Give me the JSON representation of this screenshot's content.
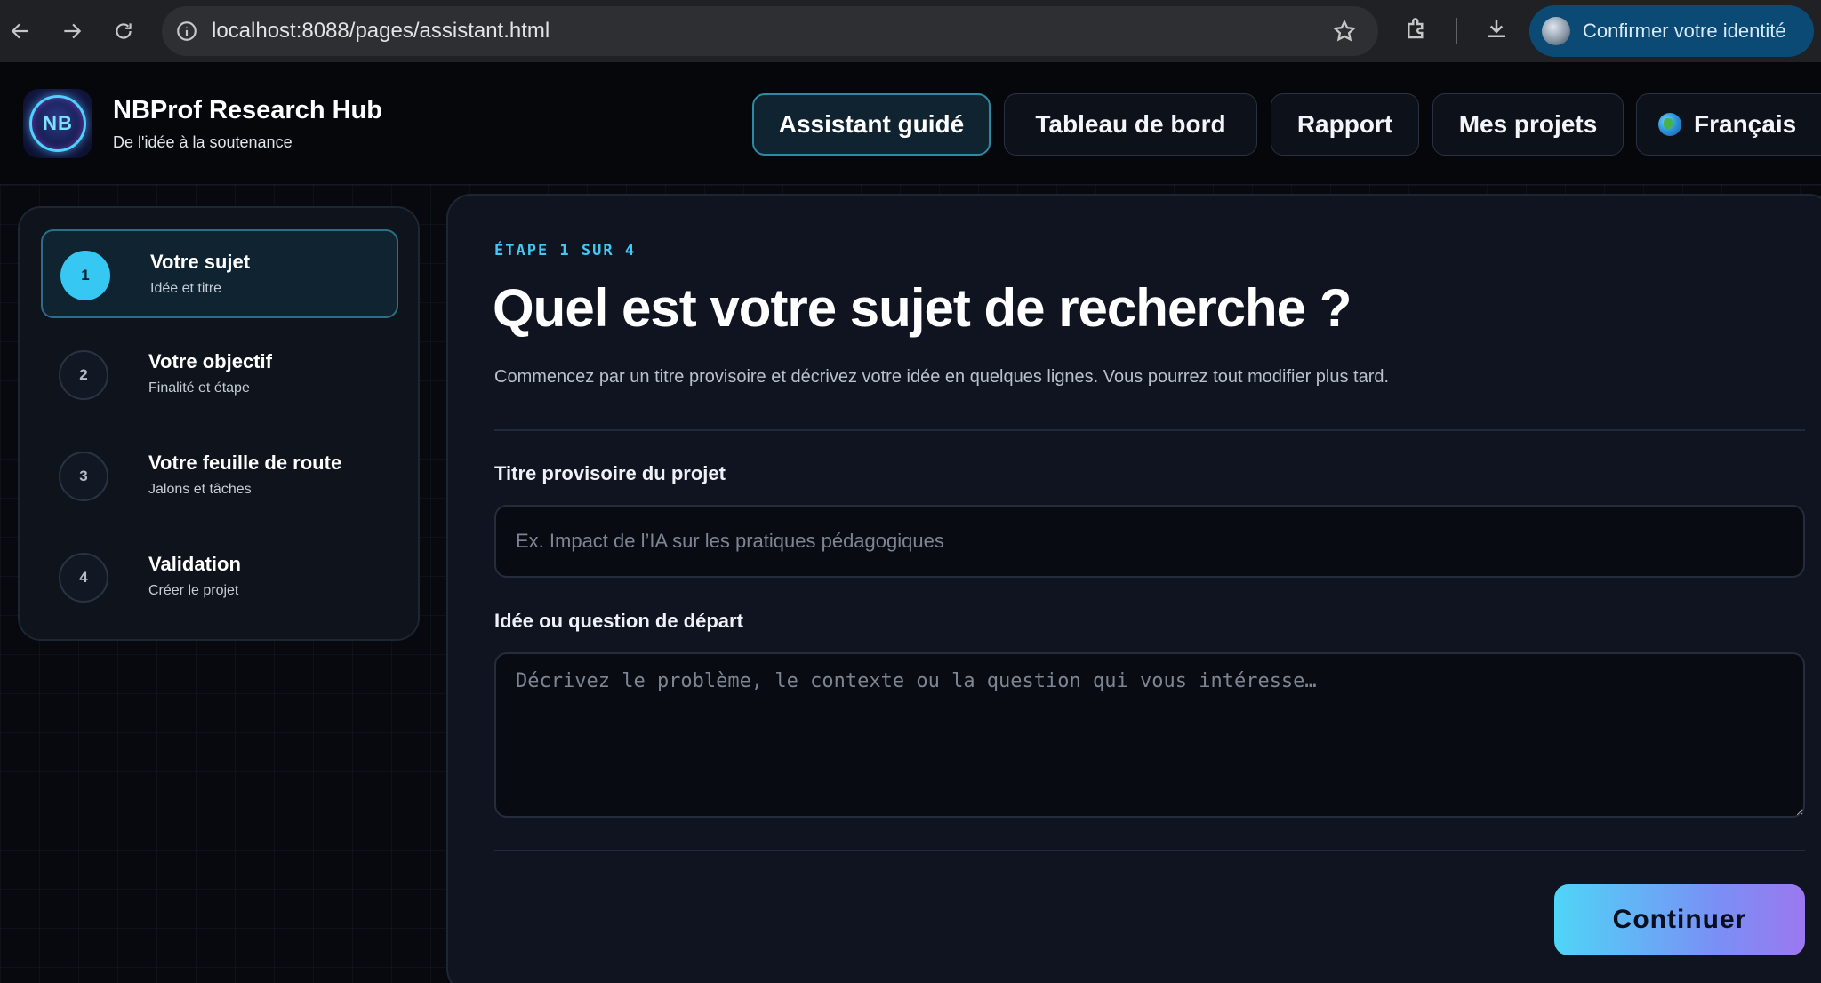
{
  "browser": {
    "url": "localhost:8088/pages/assistant.html",
    "profile_label": "Confirmer votre identité",
    "icons": [
      "back-arrow-icon",
      "forward-arrow-icon",
      "reload-icon",
      "info-icon",
      "star-icon",
      "extensions-icon",
      "download-icon"
    ]
  },
  "header": {
    "brand_title": "NBProf Research Hub",
    "brand_subtitle": "De l'idée à la soutenance",
    "logo_text": "NB",
    "nav": [
      {
        "label": "Assistant guidé",
        "active": true
      },
      {
        "label": "Tableau de bord",
        "active": false
      },
      {
        "label": "Rapport",
        "active": false
      },
      {
        "label": "Mes projets",
        "active": false
      }
    ],
    "language": "Français"
  },
  "stepper": {
    "steps": [
      {
        "num": "1",
        "title": "Votre sujet",
        "subtitle": "Idée et titre",
        "active": true
      },
      {
        "num": "2",
        "title": "Votre objectif",
        "subtitle": "Finalité et étape",
        "active": false
      },
      {
        "num": "3",
        "title": "Votre feuille de route",
        "subtitle": "Jalons et tâches",
        "active": false
      },
      {
        "num": "4",
        "title": "Validation",
        "subtitle": "Créer le projet",
        "active": false
      }
    ]
  },
  "main": {
    "eyebrow": "ÉTAPE 1 SUR 4",
    "heading": "Quel est votre sujet de recherche ?",
    "lead": "Commencez par un titre provisoire et décrivez votre idée en quelques lignes. Vous pourrez tout modifier plus tard.",
    "title_label": "Titre provisoire du projet",
    "title_value": "",
    "title_placeholder": "Ex. Impact de l’IA sur les pratiques pédagogiques",
    "idea_label": "Idée ou question de départ",
    "idea_value": "",
    "idea_placeholder": "Décrivez le problème, le contexte ou la question qui vous intéresse…",
    "continue_label": "Continuer"
  },
  "colors": {
    "accent": "#36c7f2",
    "background": "#07090e",
    "card": "#0f1420",
    "button_gradient_start": "#4fd5f7",
    "button_gradient_end": "#9b78f0"
  }
}
